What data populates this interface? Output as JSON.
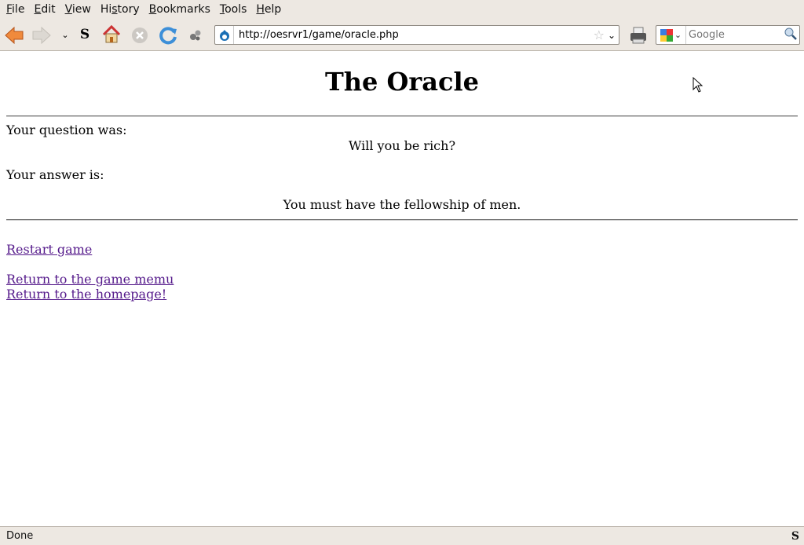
{
  "menu": [
    {
      "key": "F",
      "rest": "ile"
    },
    {
      "key": "E",
      "rest": "dit"
    },
    {
      "key": "V",
      "rest": "iew"
    },
    {
      "pre": "Hi",
      "key": "s",
      "rest": "tory"
    },
    {
      "key": "B",
      "rest": "ookmarks"
    },
    {
      "key": "T",
      "rest": "ools"
    },
    {
      "key": "H",
      "rest": "elp"
    }
  ],
  "toolbar": {
    "url": "http://oesrvr1/game/oracle.php",
    "search_placeholder": "Google"
  },
  "page": {
    "title": "The Oracle",
    "question_label": "Your question was:",
    "question": "Will you be rich?",
    "answer_label": "Your answer is:",
    "answer": "You must have the fellowship of men.",
    "links": [
      "Restart game",
      "Return to the game memu",
      "Return to the homepage!"
    ]
  },
  "status": {
    "text": "Done"
  },
  "colors": {
    "chrome": "#ede8e2",
    "visited_link": "#551a8b"
  }
}
